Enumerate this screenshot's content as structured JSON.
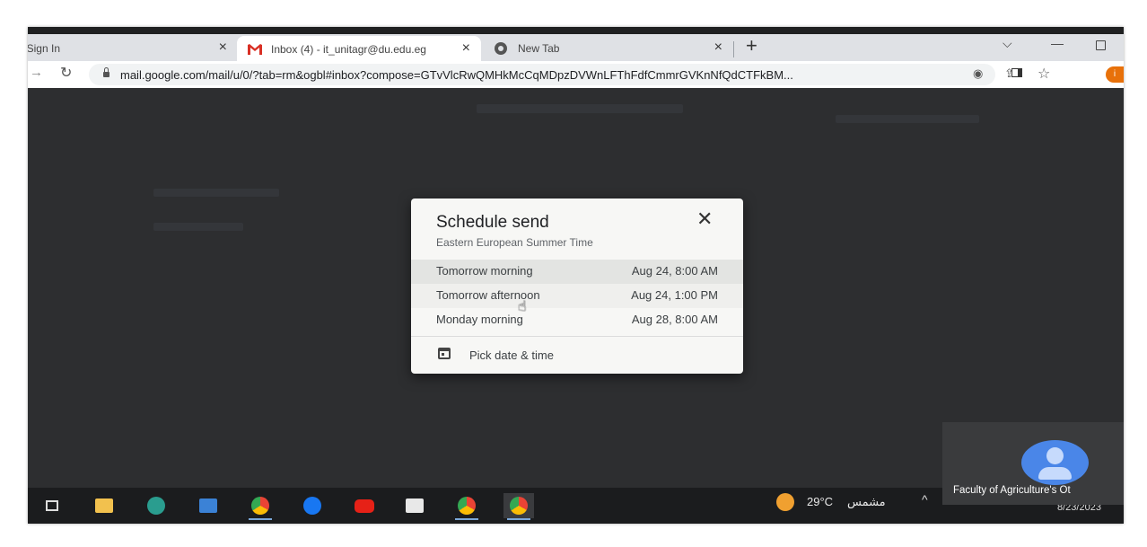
{
  "browser": {
    "tabs": [
      {
        "label": "Sign In"
      },
      {
        "label": "Inbox (4) - it_unitagr@du.edu.eg"
      },
      {
        "label": "New Tab"
      }
    ],
    "url": "mail.google.com/mail/u/0/?tab=rm&ogbl#inbox?compose=GTvVlcRwQMHkMcCqMDpzDVWnLFThFdfCmmrGVKnNfQdCTFkBM...",
    "profile_initial": "i"
  },
  "dialog": {
    "title": "Schedule send",
    "timezone": "Eastern European Summer Time",
    "options": [
      {
        "label": "Tomorrow morning",
        "datetime": "Aug 24, 8:00 AM"
      },
      {
        "label": "Tomorrow afternoon",
        "datetime": "Aug 24, 1:00 PM"
      },
      {
        "label": "Monday morning",
        "datetime": "Aug 28, 8:00 AM"
      }
    ],
    "pick_label": "Pick date & time"
  },
  "taskbar": {
    "weather_temp": "29°C",
    "weather_condition": "مشمس",
    "date": "8/23/2023"
  },
  "meeting": {
    "participant": "Faculty of Agriculture's Ot"
  },
  "colors": {
    "gmail_red": "#d93025",
    "profile_orange": "#e8710a",
    "meet_avatar_blue": "#4a86e8"
  }
}
